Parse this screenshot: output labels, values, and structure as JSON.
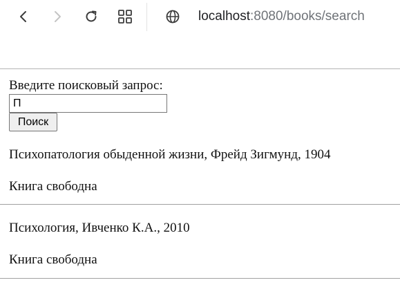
{
  "browser": {
    "url_host": "localhost",
    "url_path": ":8080/books/search",
    "icons": [
      "back-icon",
      "forward-icon",
      "reload-icon",
      "apps-icon",
      "globe-icon"
    ]
  },
  "search": {
    "label": "Введите поисковый запрос:",
    "input_value": "П",
    "button_label": "Поиск"
  },
  "results": [
    {
      "title": "Психопатология обыденной жизни, Фрейд Зигмунд, 1904",
      "status": "Книга свободна"
    },
    {
      "title": "Психология, Ивченко К.А., 2010",
      "status": "Книга свободна"
    }
  ]
}
